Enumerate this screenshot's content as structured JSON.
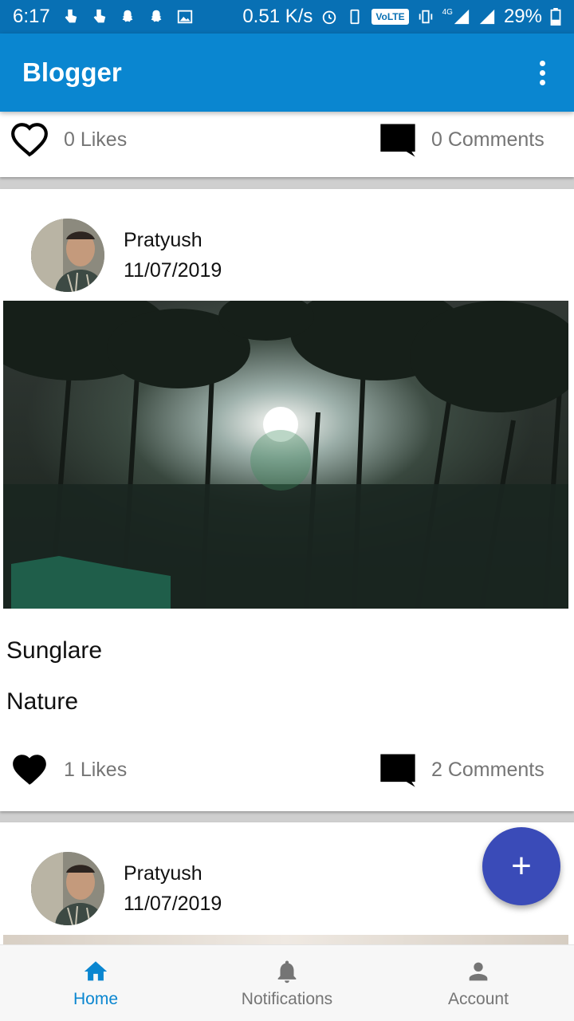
{
  "status_bar": {
    "time": "6:17",
    "speed": "0.51 K/s",
    "volte": "VoLTE",
    "network": "4G",
    "battery": "29%"
  },
  "app_bar": {
    "title": "Blogger",
    "accent": "#0a86d0"
  },
  "posts": [
    {
      "likes": "0 Likes",
      "comments": "0 Comments",
      "liked": false
    },
    {
      "author": "Pratyush",
      "date": "11/07/2019",
      "title": "Sunglare",
      "body": "Nature",
      "likes": "1 Likes",
      "comments": "2 Comments",
      "liked": true
    },
    {
      "author": "Pratyush",
      "date": "11/07/2019"
    }
  ],
  "fab": {
    "label": "+"
  },
  "bottom_nav": {
    "items": [
      {
        "label": "Home",
        "icon": "home-icon",
        "active": true
      },
      {
        "label": "Notifications",
        "icon": "bell-icon",
        "active": false
      },
      {
        "label": "Account",
        "icon": "person-icon",
        "active": false
      }
    ]
  }
}
